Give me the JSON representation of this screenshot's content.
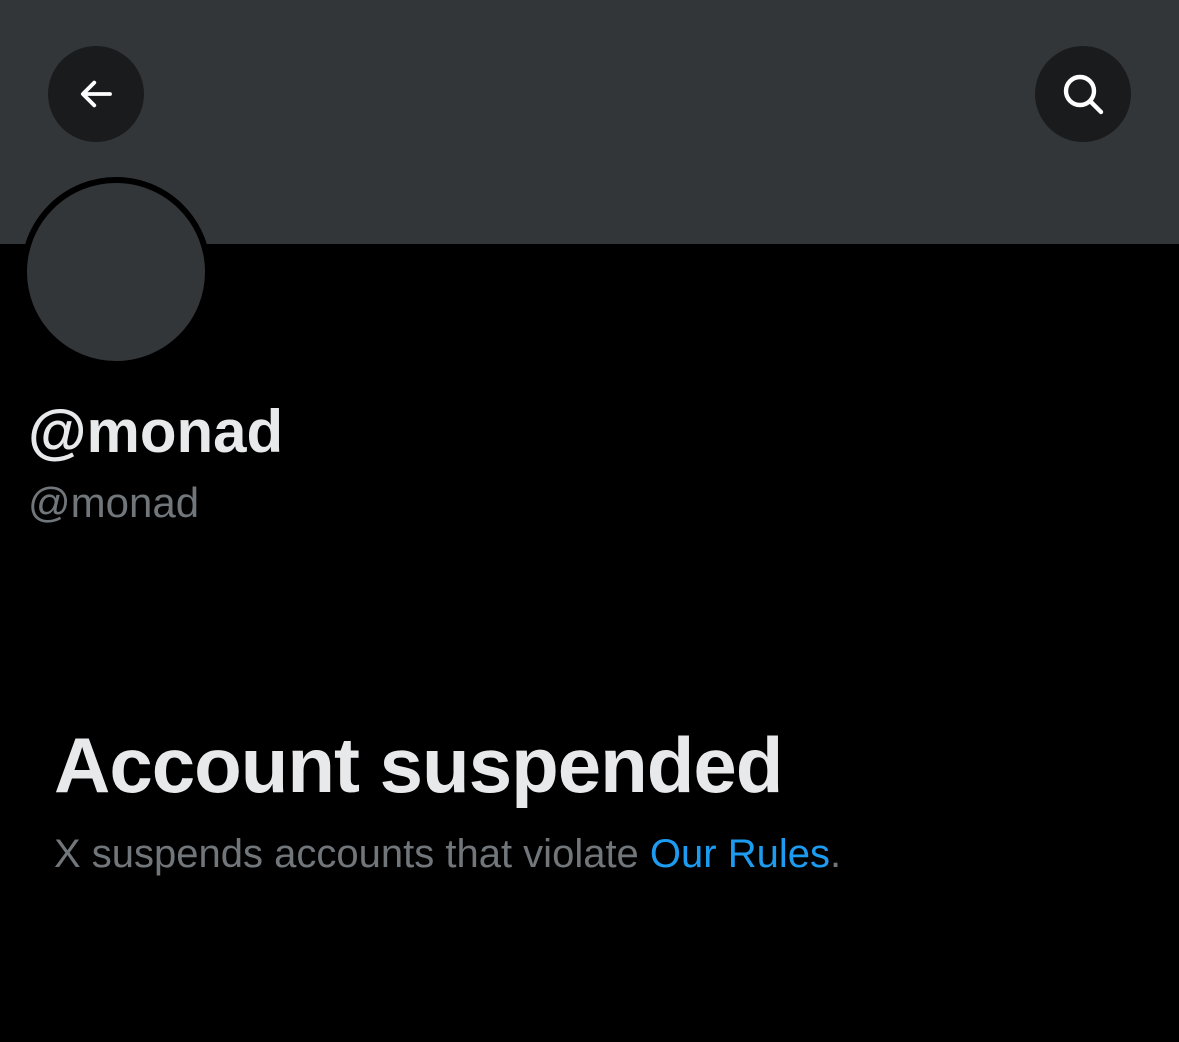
{
  "header": {
    "back_icon": "arrow-left-icon",
    "search_icon": "search-icon"
  },
  "profile": {
    "display_name": "@monad",
    "handle": "@monad"
  },
  "notice": {
    "title": "Account suspended",
    "text_before": "X suspends accounts that violate ",
    "link_label": "Our Rules",
    "text_after": "."
  },
  "colors": {
    "background": "#000000",
    "banner": "#333639",
    "button_bg": "#1a1b1d",
    "primary_text": "#e7e9ea",
    "secondary_text": "#71767b",
    "link": "#1d9bf0"
  }
}
